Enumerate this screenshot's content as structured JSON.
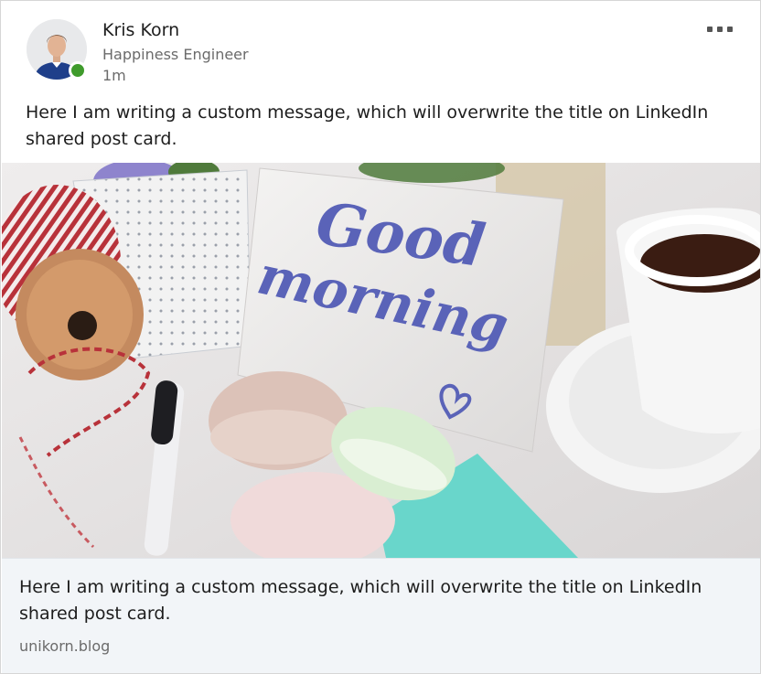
{
  "post": {
    "author": {
      "name": "Kris Korn",
      "title": "Happiness Engineer",
      "time": "1m",
      "status": "online",
      "status_color": "#3f9b2c"
    },
    "more_icon": "more-horizontal-icon",
    "message": "Here I am writing a custom message, which will overwrite the title on LinkedIn shared post card.",
    "image_card_text": [
      "Good",
      "morning"
    ],
    "link_preview": {
      "title": "Here I am writing a custom message, which will overwrite the title on LinkedIn shared post card.",
      "domain": "unikorn.blog",
      "background": "#f2f5f8"
    }
  }
}
